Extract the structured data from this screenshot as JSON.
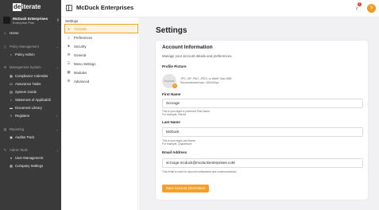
{
  "brand": {
    "logo_box": "de",
    "logo_rest": "iterate"
  },
  "org": {
    "name": "McDuck Enterprises",
    "plan": "Enterprise Plan"
  },
  "sidebar": {
    "home": "Home",
    "sections": [
      {
        "title": "Policy Management",
        "items": [
          "Policy Admin"
        ]
      },
      {
        "title": "Management System",
        "items": [
          "Compliance Calendar",
          "Assurance Tasks",
          "System Guide",
          "Statement of Applicabili",
          "Document Library",
          "Registers"
        ]
      },
      {
        "title": "Reporting",
        "items": [
          "Auditor Pack"
        ]
      },
      {
        "title": "Admin Tools",
        "items": [
          "User Management",
          "Company Settings"
        ]
      }
    ]
  },
  "topbar": {
    "title": "McDuck Enterprises",
    "notification_count": "1",
    "avatar_initial": "S"
  },
  "settings_nav": {
    "title": "Settings",
    "items": [
      "Account",
      "Preferences",
      "Security",
      "General",
      "Menu Settings",
      "Modules",
      "Advanced"
    ],
    "active": "Account"
  },
  "main": {
    "title": "Settings",
    "card": {
      "title": "Account Information",
      "subtitle": "Manage your account details and preferences.",
      "profile_label": "Profile Picture",
      "photo_placeholder": "No photo",
      "photo_hint_1": "JPG, GIF, PNG, JPEG, or WebP. Max 2MB",
      "photo_hint_2": "Recommended size: 400x400px",
      "first_name_label": "First Name",
      "first_name_value": "Scrooge",
      "first_name_help_1": "This is your legal or preferred First Name.",
      "first_name_help_2": "For example, Harold",
      "last_name_label": "Last Name",
      "last_name_value": "McDuck",
      "last_name_help_1": "This is your legal Last Name.",
      "last_name_help_2": "For example, Quackmore",
      "email_label": "Email Address",
      "email_value": "scrooge.mcduck@mcduckenterprises.coM",
      "email_help": "This email is used for account notifications and communications.",
      "save_label": "Save Account Information"
    }
  },
  "colors": {
    "accent": "#f5a028",
    "sidebar_bg": "#3a3a3a",
    "main_bg": "#f1f1f3"
  }
}
